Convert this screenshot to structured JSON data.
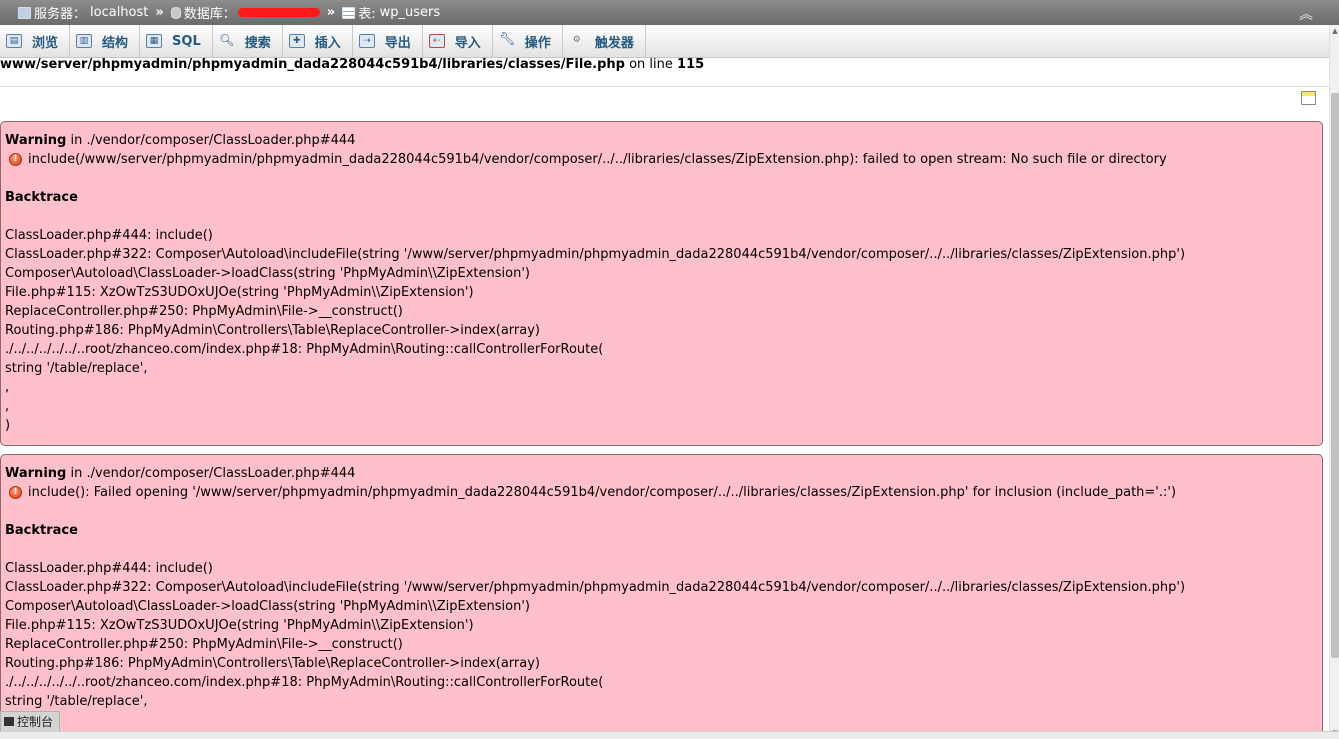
{
  "breadcrumb": {
    "server_label": "服务器：",
    "server_value": "localhost",
    "separator": "»",
    "database_label": "数据库：",
    "table_label": "表:",
    "table_value": "wp_users"
  },
  "tabs": [
    {
      "label": "浏览",
      "icon": "browse-icon"
    },
    {
      "label": "结构",
      "icon": "structure-icon"
    },
    {
      "label": "SQL",
      "icon": "sql-icon"
    },
    {
      "label": "搜索",
      "icon": "search-icon"
    },
    {
      "label": "插入",
      "icon": "insert-icon"
    },
    {
      "label": "导出",
      "icon": "export-icon"
    },
    {
      "label": "导入",
      "icon": "import-icon"
    },
    {
      "label": "操作",
      "icon": "wrench-icon"
    },
    {
      "label": "触发器",
      "icon": "triggers-icon"
    }
  ],
  "error_path": {
    "path": "www/server/phpmyadmin/phpmyadmin_dada228044c591b4/libraries/classes/File.php",
    "on_line_text": "on line",
    "line": "115"
  },
  "warnings": [
    {
      "label": "Warning",
      "in_text": "in ./vendor/composer/ClassLoader.php#444",
      "message": "include(/www/server/phpmyadmin/phpmyadmin_dada228044c591b4/vendor/composer/../../libraries/classes/ZipExtension.php): failed to open stream: No such file or directory",
      "backtrace_label": "Backtrace",
      "backtrace": [
        "ClassLoader.php#444: include()",
        "ClassLoader.php#322: Composer\\Autoload\\includeFile(string '/www/server/phpmyadmin/phpmyadmin_dada228044c591b4/vendor/composer/../../libraries/classes/ZipExtension.php')",
        "Composer\\Autoload\\ClassLoader->loadClass(string 'PhpMyAdmin\\\\ZipExtension')",
        "File.php#115: XzOwTzS3UDOxUJOe(string 'PhpMyAdmin\\\\ZipExtension')",
        "ReplaceController.php#250: PhpMyAdmin\\File->__construct()",
        "Routing.php#186: PhpMyAdmin\\Controllers\\Table\\ReplaceController->index(array)",
        "./../../../../../..root/zhanceo.com/index.php#18: PhpMyAdmin\\Routing::callControllerForRoute(",
        "string '/table/replace',",
        ",",
        ",",
        ")"
      ]
    },
    {
      "label": "Warning",
      "in_text": "in ./vendor/composer/ClassLoader.php#444",
      "message": "include(): Failed opening '/www/server/phpmyadmin/phpmyadmin_dada228044c591b4/vendor/composer/../../libraries/classes/ZipExtension.php' for inclusion (include_path='.:')",
      "backtrace_label": "Backtrace",
      "backtrace": [
        "ClassLoader.php#444: include()",
        "ClassLoader.php#322: Composer\\Autoload\\includeFile(string '/www/server/phpmyadmin/phpmyadmin_dada228044c591b4/vendor/composer/../../libraries/classes/ZipExtension.php')",
        "Composer\\Autoload\\ClassLoader->loadClass(string 'PhpMyAdmin\\\\ZipExtension')",
        "File.php#115: XzOwTzS3UDOxUJOe(string 'PhpMyAdmin\\\\ZipExtension')",
        "ReplaceController.php#250: PhpMyAdmin\\File->__construct()",
        "Routing.php#186: PhpMyAdmin\\Controllers\\Table\\ReplaceController->index(array)",
        "./../../../../../..root/zhanceo.com/index.php#18: PhpMyAdmin\\Routing::callControllerForRoute(",
        "string '/table/replace',"
      ]
    }
  ],
  "console": {
    "label": "控制台"
  },
  "colors": {
    "warning_bg": "#ffc0cb",
    "tab_text": "#235a81",
    "breadcrumb_bg": "#7a7a7a"
  }
}
